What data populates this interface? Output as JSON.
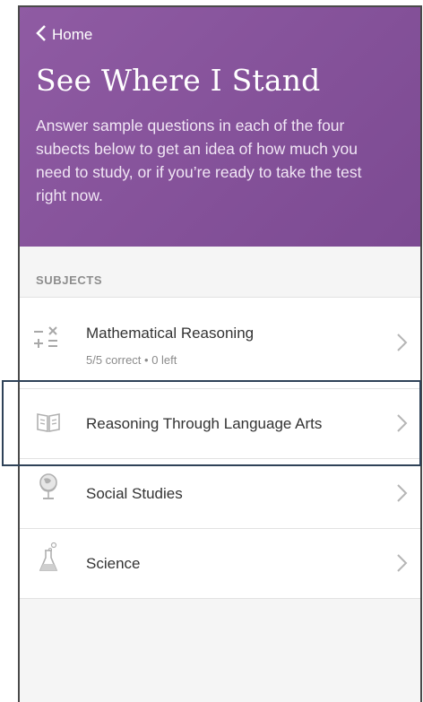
{
  "header": {
    "back_label": "Home",
    "title": "See Where I Stand",
    "description": "Answer sample questions in each of the four subects below to get an idea of how much you need to study, or if you’re ready to take the test right now."
  },
  "section": {
    "label": "SUBJECTS"
  },
  "subjects": [
    {
      "name": "Mathematical Reasoning",
      "status": "5/5 correct • 0 left",
      "icon": "math-symbols-icon"
    },
    {
      "name": "Reasoning Through Language Arts",
      "status": "",
      "icon": "book-icon"
    },
    {
      "name": "Social Studies",
      "status": "",
      "icon": "globe-icon"
    },
    {
      "name": "Science",
      "status": "",
      "icon": "flask-icon"
    }
  ]
}
